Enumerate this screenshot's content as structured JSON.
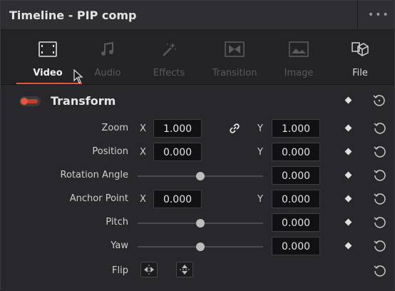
{
  "window": {
    "title": "Timeline - PIP comp"
  },
  "tabs": [
    {
      "label": "Video",
      "icon": "film-icon",
      "state": "active"
    },
    {
      "label": "Audio",
      "icon": "music-note-icon",
      "state": "dim"
    },
    {
      "label": "Effects",
      "icon": "magic-wand-icon",
      "state": "dim"
    },
    {
      "label": "Transition",
      "icon": "transition-icon",
      "state": "dim"
    },
    {
      "label": "Image",
      "icon": "image-icon",
      "state": "dim"
    },
    {
      "label": "File",
      "icon": "file-icon",
      "state": "on"
    }
  ],
  "transform": {
    "title": "Transform",
    "enabled": true,
    "zoom": {
      "label": "Zoom",
      "x_axis": "X",
      "x": "1.000",
      "y_axis": "Y",
      "y": "1.000",
      "linked": true
    },
    "position": {
      "label": "Position",
      "x_axis": "X",
      "x": "0.000",
      "y_axis": "Y",
      "y": "0.000"
    },
    "rotation": {
      "label": "Rotation Angle",
      "value": "0.000",
      "slider": 0.5
    },
    "anchor": {
      "label": "Anchor Point",
      "x_axis": "X",
      "x": "0.000",
      "y_axis": "Y",
      "y": "0.000"
    },
    "pitch": {
      "label": "Pitch",
      "value": "0.000",
      "slider": 0.5
    },
    "yaw": {
      "label": "Yaw",
      "value": "0.000",
      "slider": 0.5
    },
    "flip": {
      "label": "Flip"
    }
  },
  "colors": {
    "accent": "#e8553d",
    "panel": "#27272b",
    "field": "#111113"
  }
}
